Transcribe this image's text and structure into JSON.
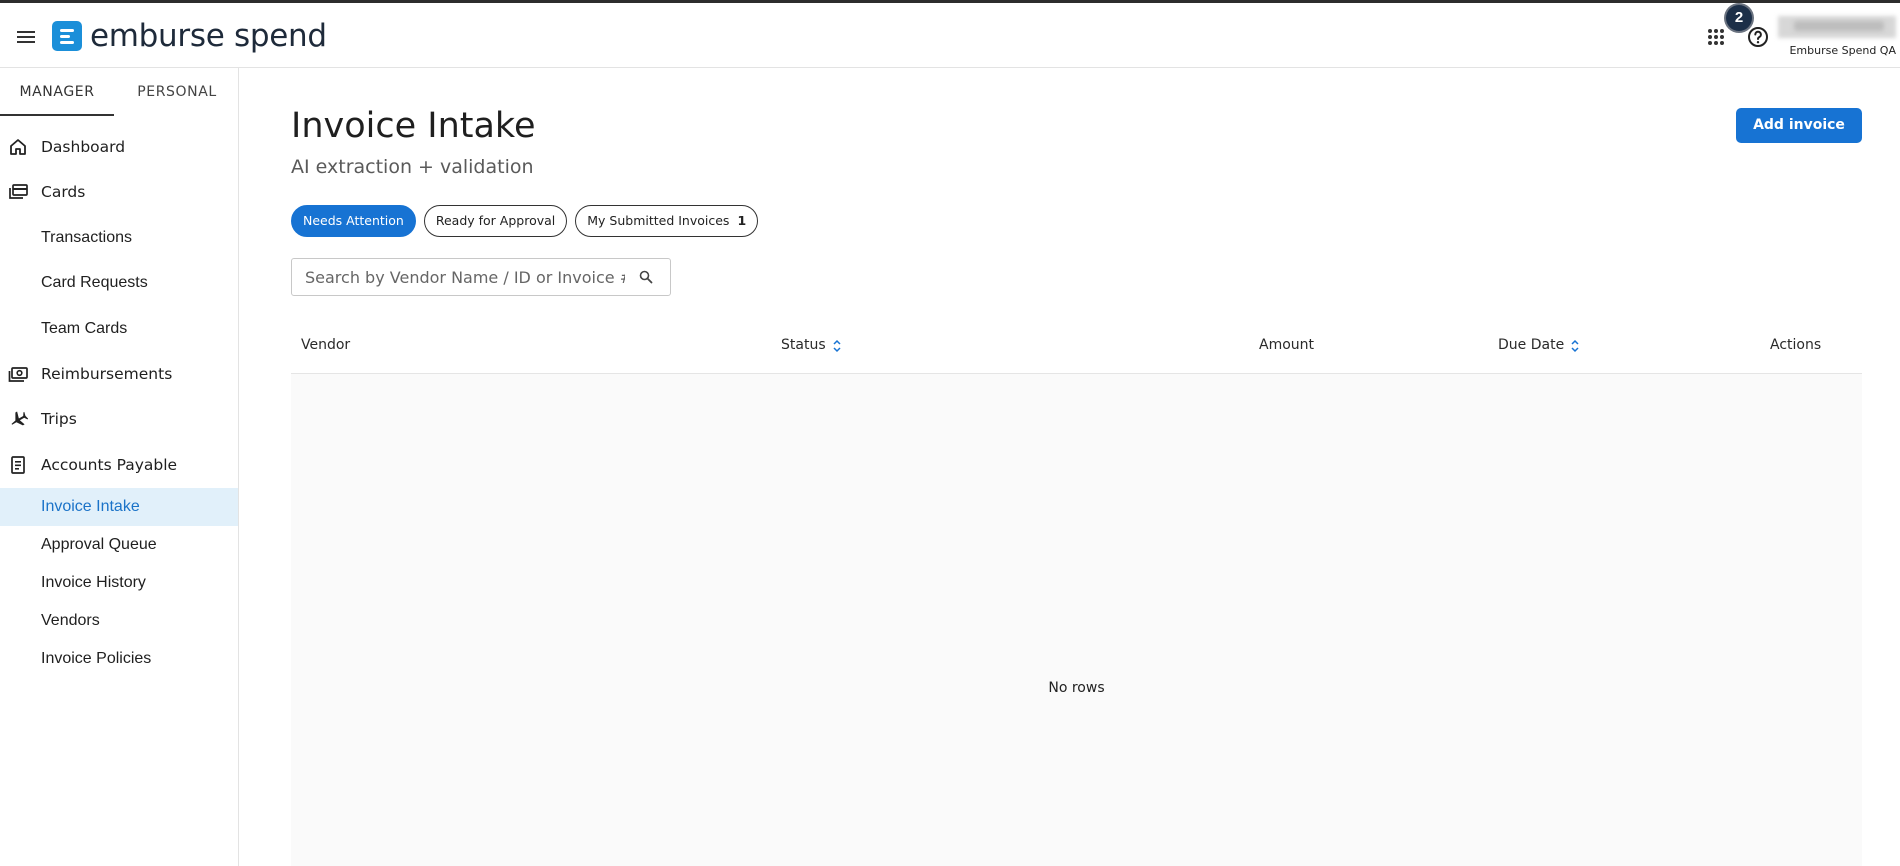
{
  "header": {
    "brand": "emburse spend",
    "notification_count": "2",
    "org_name": "Emburse Spend QA",
    "icons": [
      "menu-icon",
      "apps-grid-icon",
      "help-icon"
    ]
  },
  "sidebar": {
    "tabs": [
      {
        "label": "MANAGER",
        "active": true
      },
      {
        "label": "PERSONAL",
        "active": false
      }
    ],
    "items": [
      {
        "label": "Dashboard",
        "icon": "home-icon"
      },
      {
        "label": "Cards",
        "icon": "cards-icon"
      },
      {
        "label": "Transactions"
      },
      {
        "label": "Card Requests"
      },
      {
        "label": "Team Cards"
      },
      {
        "label": "Reimbursements",
        "icon": "cash-icon"
      },
      {
        "label": "Trips",
        "icon": "airplane-icon"
      },
      {
        "label": "Accounts Payable",
        "icon": "receipt-icon"
      },
      {
        "label": "Invoice Intake",
        "active": true
      },
      {
        "label": "Approval Queue"
      },
      {
        "label": "Invoice History"
      },
      {
        "label": "Vendors"
      },
      {
        "label": "Invoice Policies"
      }
    ]
  },
  "main": {
    "title": "Invoice Intake",
    "subtitle": "AI extraction + validation",
    "add_button": "Add invoice",
    "filters": [
      {
        "label": "Needs Attention",
        "active": true
      },
      {
        "label": "Ready for Approval",
        "active": false
      },
      {
        "label": "My Submitted Invoices",
        "count": "1",
        "active": false
      }
    ],
    "search": {
      "placeholder": "Search by Vendor Name / ID or Invoice #",
      "value": ""
    },
    "table": {
      "columns": [
        "Vendor",
        "Status",
        "Amount",
        "Due Date",
        "Actions"
      ],
      "rows": [],
      "empty_text": "No rows"
    }
  },
  "colors": {
    "accent": "#1773d3",
    "active_nav_bg": "#e1f0fa",
    "active_nav_text": "#1b73c8",
    "brand": "#1b8fd9"
  }
}
